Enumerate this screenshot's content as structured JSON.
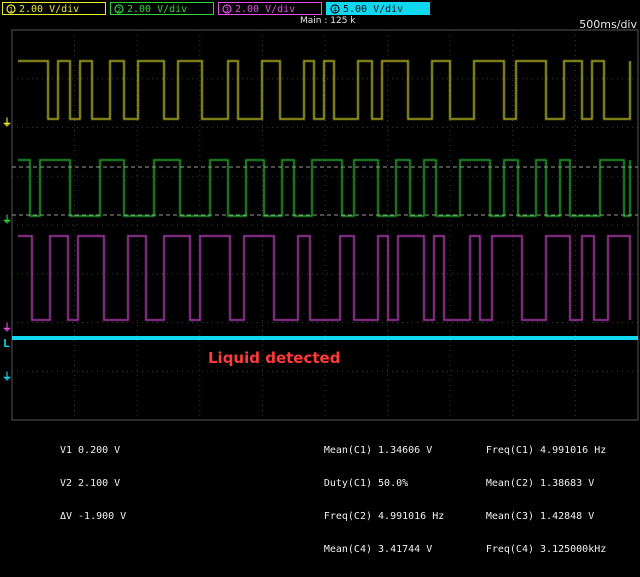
{
  "channels": [
    {
      "label": "2.00 V/div",
      "color": "#e8ea2a",
      "icon": "channel-1-icon"
    },
    {
      "label": "2.00 V/div",
      "color": "#2fd33a",
      "icon": "channel-2-icon"
    },
    {
      "label": "2.00 V/div",
      "color": "#e34fe2",
      "icon": "channel-3-icon"
    },
    {
      "label": "5.00 V/div",
      "color": "#10d8f0",
      "icon": "channel-4-icon"
    }
  ],
  "main_label": "Main : 125 k",
  "timebase": "500ms/div",
  "annotation": "Liquid detected",
  "cursors": [
    {
      "name": "V1",
      "value": "0.200 V"
    },
    {
      "name": "V2",
      "value": "2.100 V"
    },
    {
      "name": "ΔV",
      "value": "-1.900 V"
    }
  ],
  "measure_col1": [
    {
      "name": "Mean(C1)",
      "value": "1.34606 V"
    },
    {
      "name": "Duty(C1)",
      "value": "50.0%"
    },
    {
      "name": "Freq(C2)",
      "value": "4.991016 Hz"
    },
    {
      "name": "Mean(C4)",
      "value": "3.41744 V"
    }
  ],
  "measure_col2": [
    {
      "name": "Freq(C1)",
      "value": "4.991016 Hz"
    },
    {
      "name": "Mean(C2)",
      "value": "1.38683 V"
    },
    {
      "name": "Mean(C3)",
      "value": "1.42848 V"
    },
    {
      "name": "Freq(C4)",
      "value": "3.125000kHz"
    }
  ],
  "colors": {
    "ch1": "#e8ea2a",
    "ch2": "#2fd33a",
    "ch3": "#e34fe2",
    "ch4": "#10d8f0",
    "annotation": "#ff3a3a",
    "grid": "#3a3a3a"
  }
}
